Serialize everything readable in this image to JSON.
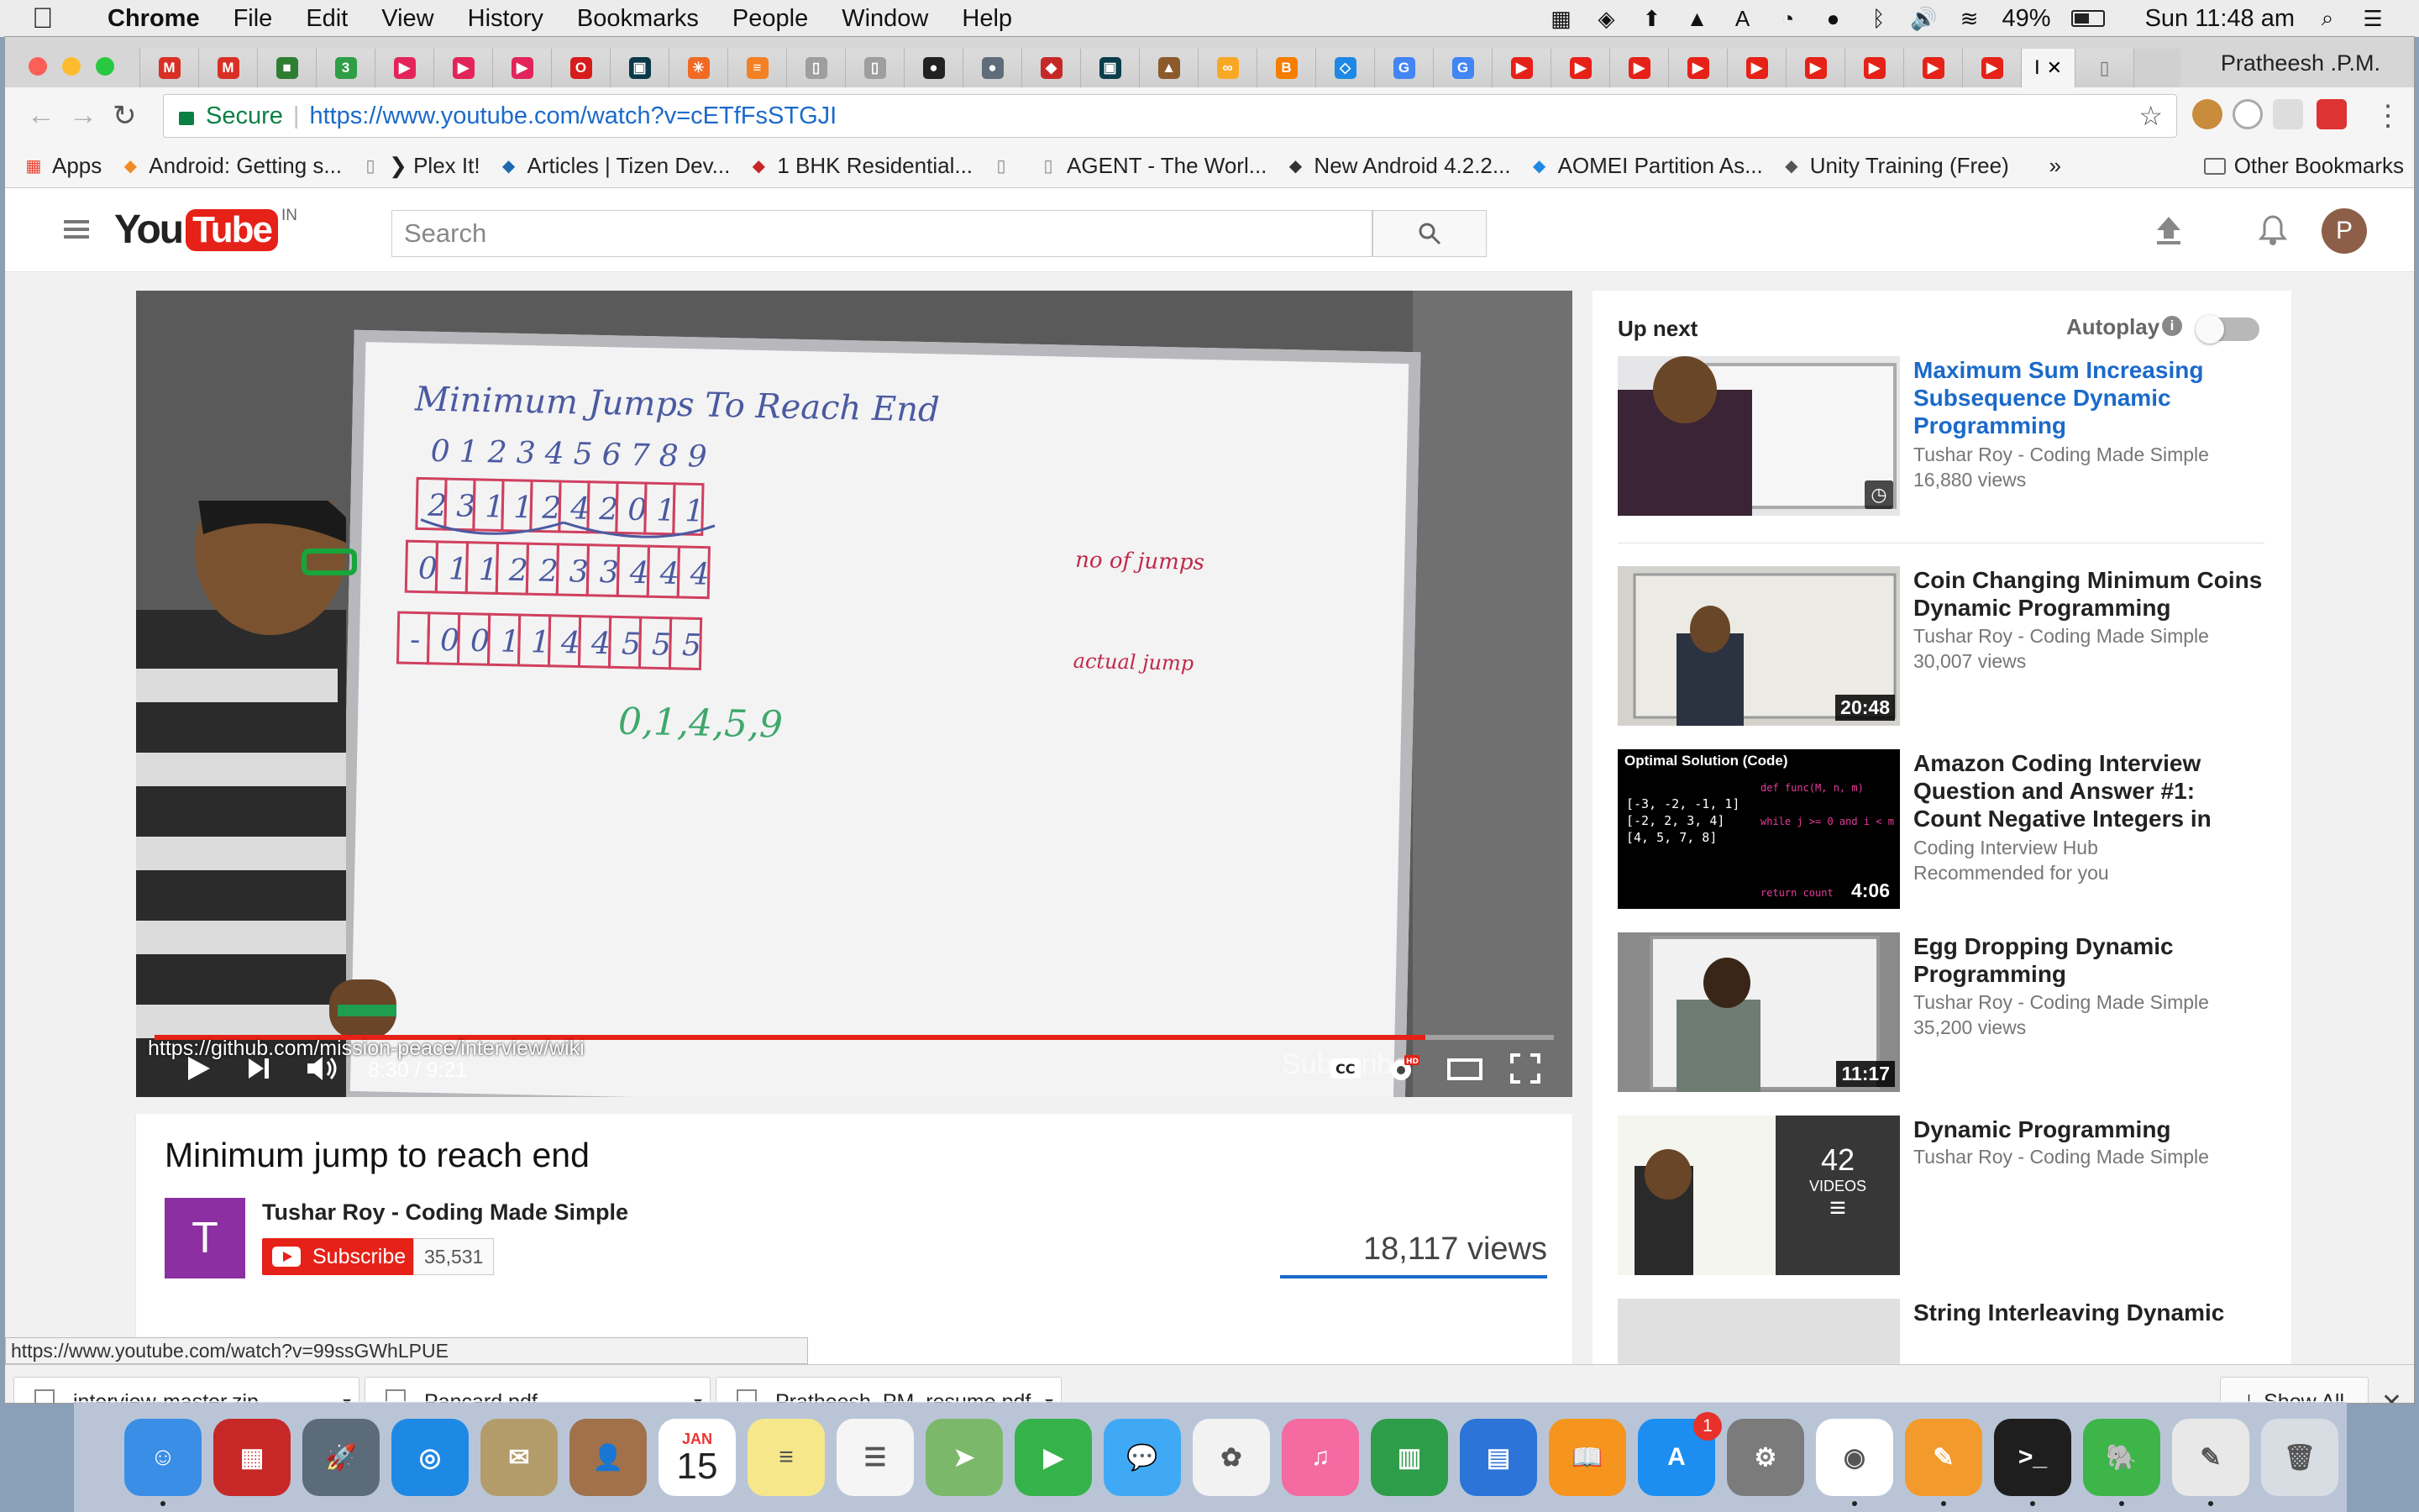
{
  "menubar": {
    "app_name": "Chrome",
    "items": [
      "File",
      "Edit",
      "View",
      "History",
      "Bookmarks",
      "People",
      "Window",
      "Help"
    ],
    "battery": "49%",
    "clock": "Sun 11:48 am"
  },
  "browser": {
    "profile_name": "Pratheesh .P.M.",
    "active_tab_label": "I",
    "tab_favicons": [
      {
        "icon": "gmail-icon",
        "color": "#d93025",
        "glyph": "M"
      },
      {
        "icon": "gmail-icon",
        "color": "#d93025",
        "glyph": "M"
      },
      {
        "icon": "cube-icon",
        "color": "#2e7d32",
        "glyph": "■"
      },
      {
        "icon": "counter-icon",
        "color": "#2e9e47",
        "glyph": "3"
      },
      {
        "icon": "play-icon",
        "color": "#e3245a",
        "glyph": "▶"
      },
      {
        "icon": "play-icon",
        "color": "#e3245a",
        "glyph": "▶"
      },
      {
        "icon": "play-icon",
        "color": "#e3245a",
        "glyph": "▶"
      },
      {
        "icon": "opera-icon",
        "color": "#d81b1b",
        "glyph": "O"
      },
      {
        "icon": "terminal-icon",
        "color": "#0a3a4a",
        "glyph": "▣"
      },
      {
        "icon": "burst-icon",
        "color": "#f06a23",
        "glyph": "✳"
      },
      {
        "icon": "stack-icon",
        "color": "#f48024",
        "glyph": "≡"
      },
      {
        "icon": "doc-icon",
        "color": "#9e9e9e",
        "glyph": "▯"
      },
      {
        "icon": "doc-icon",
        "color": "#9e9e9e",
        "glyph": "▯"
      },
      {
        "icon": "github-icon",
        "color": "#222222",
        "glyph": "●"
      },
      {
        "icon": "reddit-icon",
        "color": "#5f6c79",
        "glyph": "●"
      },
      {
        "icon": "shield-icon",
        "color": "#c62828",
        "glyph": "◆"
      },
      {
        "icon": "monitor-icon",
        "color": "#0b3d4a",
        "glyph": "▣"
      },
      {
        "icon": "poop-icon",
        "color": "#8d5a2b",
        "glyph": "▲"
      },
      {
        "icon": "infinity-icon",
        "color": "#f9a825",
        "glyph": "∞"
      },
      {
        "icon": "blogger-icon",
        "color": "#f57d00",
        "glyph": "B"
      },
      {
        "icon": "tiles-icon",
        "color": "#1e88e5",
        "glyph": "◇"
      },
      {
        "icon": "google-icon",
        "color": "#4285f4",
        "glyph": "G"
      },
      {
        "icon": "google-icon",
        "color": "#4285f4",
        "glyph": "G"
      },
      {
        "icon": "youtube-icon",
        "color": "#e62117",
        "glyph": "▶"
      },
      {
        "icon": "youtube-icon",
        "color": "#e62117",
        "glyph": "▶"
      },
      {
        "icon": "youtube-icon",
        "color": "#e62117",
        "glyph": "▶"
      },
      {
        "icon": "youtube-icon",
        "color": "#e62117",
        "glyph": "▶"
      },
      {
        "icon": "youtube-icon",
        "color": "#e62117",
        "glyph": "▶"
      },
      {
        "icon": "youtube-icon",
        "color": "#e62117",
        "glyph": "▶"
      },
      {
        "icon": "youtube-icon",
        "color": "#e62117",
        "glyph": "▶"
      },
      {
        "icon": "youtube-icon",
        "color": "#e62117",
        "glyph": "▶"
      },
      {
        "icon": "youtube-icon",
        "color": "#e62117",
        "glyph": "▶"
      }
    ],
    "omnibox": {
      "secure_label": "Secure",
      "url": "https://www.youtube.com/watch?v=cETfFsSTGJI"
    },
    "bookmarks": [
      {
        "label": "Apps",
        "icon": "apps-grid-icon"
      },
      {
        "label": "Android: Getting s...",
        "icon": "pencil-icon"
      },
      {
        "label": "❯ Plex It!",
        "icon": "page-icon"
      },
      {
        "label": "Articles | Tizen Dev...",
        "icon": "tizen-icon"
      },
      {
        "label": "1 BHK Residential...",
        "icon": "house-icon"
      },
      {
        "label": "",
        "icon": "page-icon"
      },
      {
        "label": "AGENT - The Worl...",
        "icon": "page-icon"
      },
      {
        "label": "New Android 4.2.2...",
        "icon": "plane-icon"
      },
      {
        "label": "AOMEI Partition As...",
        "icon": "aomei-icon"
      },
      {
        "label": "Unity Training (Free)",
        "icon": "unity-icon"
      }
    ],
    "bookmarks_overflow": "»",
    "other_bookmarks": "Other Bookmarks",
    "status_url": "https://www.youtube.com/watch?v=99ssGWhLPUE"
  },
  "youtube": {
    "logo_you": "You",
    "logo_tube": "Tube",
    "region": "IN",
    "search_placeholder": "Search",
    "avatar_letter": "P",
    "player": {
      "annotation_url": "https://github.com/mission-peace/interview/wiki",
      "time": "8:30 / 9:21",
      "progress": 0.908,
      "watermark": "Subscribe",
      "board": {
        "heading": "Minimum Jumps To Reach End",
        "indices": [
          "0",
          "1",
          "2",
          "3",
          "4",
          "5",
          "6",
          "7",
          "8",
          "9"
        ],
        "array": [
          "2",
          "3",
          "1",
          "1",
          "2",
          "4",
          "2",
          "0",
          "1",
          "1"
        ],
        "jumps": [
          "0",
          "1",
          "1",
          "2",
          "2",
          "3",
          "3",
          "4",
          "4",
          "4"
        ],
        "jumps_label": "no of jumps",
        "actual": [
          "-",
          "0",
          "0",
          "1",
          "1",
          "4",
          "4",
          "5",
          "5",
          "5"
        ],
        "actual_label": "actual jump",
        "path": "0,1,4,5,9"
      }
    },
    "video": {
      "title": "Minimum jump to reach end",
      "channel_initial": "T",
      "channel": "Tushar Roy - Coding Made Simple",
      "subscribe_label": "Subscribe",
      "subscriber_count": "35,531",
      "views": "18,117 views"
    },
    "sidebar": {
      "up_next": "Up next",
      "autoplay": "Autoplay",
      "items": [
        {
          "title": "Maximum Sum Increasing Subsequence Dynamic Programming",
          "channel": "Tushar Roy - Coding Made Simple",
          "meta": "16,880 views",
          "duration": ""
        },
        {
          "title": "Coin Changing Minimum Coins Dynamic Programming",
          "channel": "Tushar Roy - Coding Made Simple",
          "meta": "30,007 views",
          "duration": "20:48"
        },
        {
          "title": "Amazon Coding Interview Question and Answer #1: Count Negative Integers in",
          "channel": "Coding Interview Hub",
          "meta": "Recommended for you",
          "duration": "4:06"
        },
        {
          "title": "Egg Dropping Dynamic Programming",
          "channel": "Tushar Roy - Coding Made Simple",
          "meta": "35,200 views",
          "duration": "11:17"
        },
        {
          "title": "Dynamic Programming",
          "channel": "Tushar Roy - Coding Made Simple",
          "meta": "",
          "duration": ""
        },
        {
          "title": "String Interleaving Dynamic",
          "channel": "",
          "meta": "",
          "duration": ""
        }
      ],
      "playlist_count": "42",
      "playlist_label": "VIDEOS",
      "thumb3_heading": "Optimal Solution (Code)"
    }
  },
  "downloads": {
    "files": [
      "interview-master.zip",
      "Pancard.pdf",
      "Pratheesh_PM_resume.pdf"
    ],
    "show_all": "Show All"
  },
  "dock": {
    "calendar_month": "JAN",
    "calendar_day": "15",
    "appstore_badge": "1",
    "apps": [
      {
        "name": "finder",
        "color": "#3a8ee6",
        "glyph": "☺"
      },
      {
        "name": "security",
        "color": "#c62828",
        "glyph": "▦"
      },
      {
        "name": "launchpad",
        "color": "#5c6b7a",
        "glyph": "🚀"
      },
      {
        "name": "safari",
        "color": "#1e88e5",
        "glyph": "◎"
      },
      {
        "name": "mail",
        "color": "#b39c6a",
        "glyph": "✉"
      },
      {
        "name": "contacts",
        "color": "#a0714a",
        "glyph": "👤"
      },
      {
        "name": "calendar",
        "color": "#ffffff",
        "glyph": ""
      },
      {
        "name": "notes",
        "color": "#f7e78b",
        "glyph": "≡"
      },
      {
        "name": "reminders",
        "color": "#f5f5f5",
        "glyph": "☰"
      },
      {
        "name": "maps",
        "color": "#7cb86a",
        "glyph": "➤"
      },
      {
        "name": "facetime",
        "color": "#35b24a",
        "glyph": "▶"
      },
      {
        "name": "messages",
        "color": "#3fa9f5",
        "glyph": "💬"
      },
      {
        "name": "photos",
        "color": "#f2f2f2",
        "glyph": "✿"
      },
      {
        "name": "itunes",
        "color": "#f46aa1",
        "glyph": "♫"
      },
      {
        "name": "numbers",
        "color": "#2e9d4a",
        "glyph": "▥"
      },
      {
        "name": "keynote",
        "color": "#2c74d8",
        "glyph": "▤"
      },
      {
        "name": "ibooks",
        "color": "#f5951d",
        "glyph": "📖"
      },
      {
        "name": "appstore",
        "color": "#1c8ef2",
        "glyph": "A"
      },
      {
        "name": "system-preferences",
        "color": "#7b7b7b",
        "glyph": "⚙"
      },
      {
        "name": "chrome",
        "color": "#ffffff",
        "glyph": "◉"
      },
      {
        "name": "pages",
        "color": "#f29b2c",
        "glyph": "✎"
      },
      {
        "name": "terminal",
        "color": "#1e1e1e",
        "glyph": ">_"
      },
      {
        "name": "evernote",
        "color": "#3db549",
        "glyph": "🐘"
      },
      {
        "name": "textedit",
        "color": "#e8e8e8",
        "glyph": "✎"
      },
      {
        "name": "trash",
        "color": "#d8dde4",
        "glyph": "🗑"
      }
    ]
  }
}
